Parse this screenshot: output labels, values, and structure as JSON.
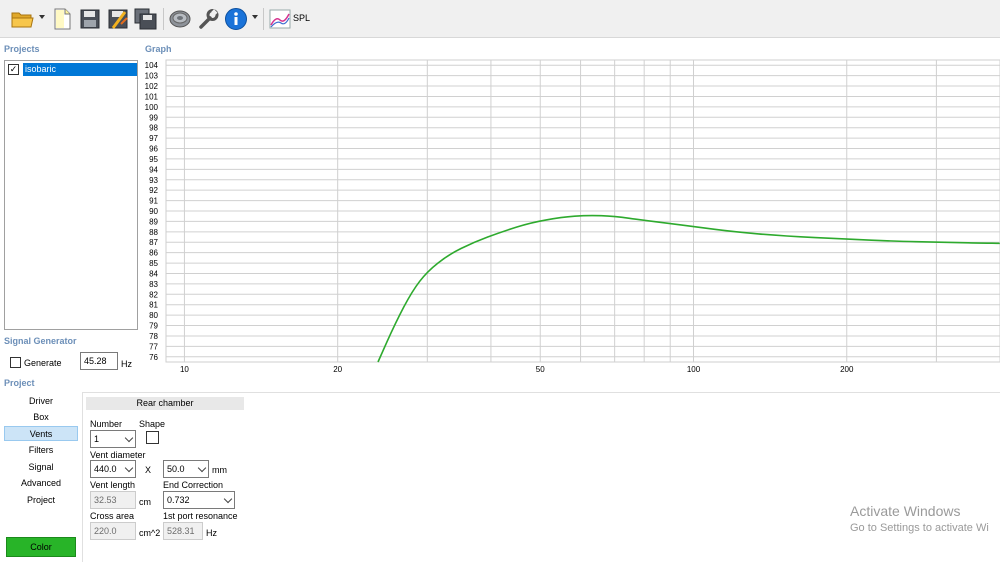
{
  "toolbar": {
    "items": [
      "open-folder-icon",
      "new-document-icon",
      "save-icon",
      "save-as-icon",
      "save-all-icon",
      "speaker-icon",
      "wrench-icon",
      "info-icon",
      "spl-chart-icon"
    ],
    "spl_label": "SPL"
  },
  "projects": {
    "title": "Projects",
    "items": [
      {
        "label": "isobaric",
        "checked": true
      }
    ]
  },
  "graph": {
    "title": "Graph"
  },
  "chart_data": {
    "type": "line",
    "x_scale": "log",
    "xlim": [
      9.2,
      400
    ],
    "ylim": [
      75.5,
      104.5
    ],
    "x_ticks": [
      10,
      20,
      50,
      100,
      200
    ],
    "x_tick_labels": [
      "10",
      "20",
      "50",
      "100",
      "200"
    ],
    "x_gridlines": [
      10,
      20,
      30,
      40,
      50,
      60,
      70,
      80,
      90,
      100,
      200,
      300,
      400
    ],
    "y_ticks": [
      76,
      77,
      78,
      79,
      80,
      81,
      82,
      83,
      84,
      85,
      86,
      87,
      88,
      89,
      90,
      91,
      92,
      93,
      94,
      95,
      96,
      97,
      98,
      99,
      100,
      101,
      102,
      103,
      104
    ],
    "grid": true,
    "series": [
      {
        "color": "#2eaa2e",
        "x": [
          24,
          26,
          28,
          30,
          33,
          37,
          42,
          48,
          55,
          62,
          70,
          80,
          90,
          100,
          120,
          150,
          200,
          250,
          300,
          400
        ],
        "y": [
          75.5,
          79.3,
          82.3,
          84.2,
          85.8,
          87.0,
          88.0,
          88.9,
          89.4,
          89.6,
          89.5,
          89.1,
          88.8,
          88.5,
          88.0,
          87.6,
          87.3,
          87.1,
          87.0,
          86.9
        ]
      }
    ]
  },
  "signal_generator": {
    "title": "Signal Generator",
    "generate_label": "Generate",
    "frequency": "45.28",
    "unit": "Hz"
  },
  "project": {
    "title": "Project",
    "nav": [
      "Driver",
      "Box",
      "Vents",
      "Filters",
      "Signal",
      "Advanced",
      "Project"
    ],
    "active": "Vents",
    "color_button": "Color"
  },
  "vents": {
    "header": "Rear chamber",
    "number_label": "Number",
    "number_value": "1",
    "shape_label": "Shape",
    "diameter_label": "Vent diameter",
    "diameter_value": "440.0",
    "x_label": "X",
    "depth_value": "50.0",
    "depth_unit": "mm",
    "length_label": "Vent length",
    "length_value": "32.53",
    "length_unit": "cm",
    "end_correction_label": "End Correction",
    "end_correction_value": "0.732",
    "cross_area_label": "Cross area",
    "cross_area_value": "220.0",
    "cross_area_unit": "cm^2",
    "resonance_label": "1st port resonance",
    "resonance_value": "528.31",
    "resonance_unit": "Hz"
  },
  "watermark": {
    "line1": "Activate Windows",
    "line2": "Go to Settings to activate Wi"
  }
}
